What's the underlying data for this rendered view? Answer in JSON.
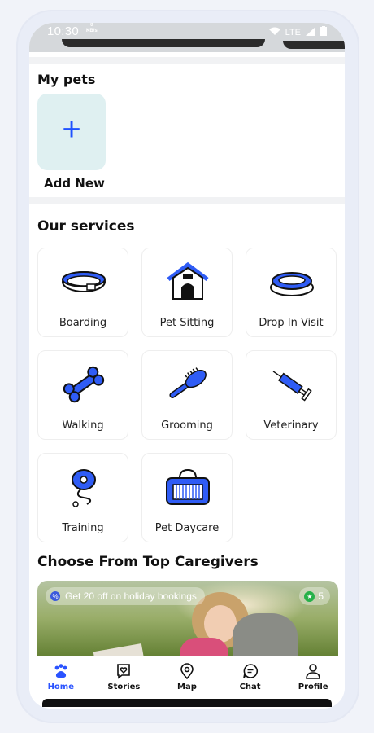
{
  "status_bar": {
    "time": "10:30",
    "kb": "0\nKB/s",
    "network": "LTE"
  },
  "my_pets": {
    "title": "My pets",
    "add_new_label": "Add New"
  },
  "services": {
    "title": "Our services",
    "items": [
      {
        "label": "Boarding",
        "icon": "collar-icon"
      },
      {
        "label": "Pet Sitting",
        "icon": "doghouse-icon"
      },
      {
        "label": "Drop In Visit",
        "icon": "bowl-icon"
      },
      {
        "label": "Walking",
        "icon": "bone-icon"
      },
      {
        "label": "Grooming",
        "icon": "brush-icon"
      },
      {
        "label": "Veterinary",
        "icon": "syringe-icon"
      },
      {
        "label": "Training",
        "icon": "leash-icon"
      },
      {
        "label": "Pet Daycare",
        "icon": "carrier-icon"
      }
    ]
  },
  "caregivers": {
    "title": "Choose From Top Caregivers",
    "promo_text": "Get 20 off on holiday bookings",
    "rating": "5"
  },
  "nav": {
    "items": [
      {
        "label": "Home",
        "icon": "paw-icon",
        "active": true
      },
      {
        "label": "Stories",
        "icon": "heart-chat-icon",
        "active": false
      },
      {
        "label": "Map",
        "icon": "location-pin-icon",
        "active": false
      },
      {
        "label": "Chat",
        "icon": "chat-bubble-icon",
        "active": false
      },
      {
        "label": "Profile",
        "icon": "person-icon",
        "active": false
      }
    ]
  },
  "colors": {
    "accent": "#2a53ff",
    "tile_bg": "#dff0f1",
    "rating_green": "#27b14a"
  }
}
